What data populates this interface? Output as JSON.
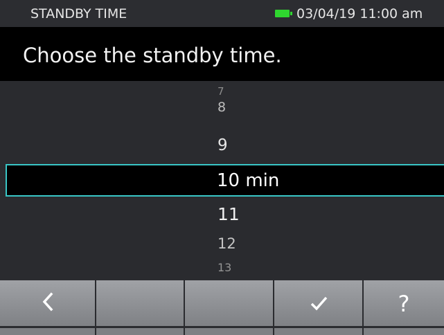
{
  "status_bar": {
    "title": "STANDBY TIME",
    "battery_icon": "battery-full-icon",
    "battery_color": "#2fd62f",
    "datetime": "03/04/19 11:00 am"
  },
  "prompt": {
    "text": "Choose the standby time."
  },
  "picker": {
    "items_above": [
      "7",
      "8",
      "9"
    ],
    "selected": "10 min",
    "items_below": [
      "11",
      "12",
      "13"
    ],
    "highlight_color": "#39c6c6"
  },
  "softkeys": [
    {
      "icon": "back-chevron-icon",
      "glyph": "<"
    },
    {
      "icon": "",
      "glyph": ""
    },
    {
      "icon": "",
      "glyph": ""
    },
    {
      "icon": "check-icon",
      "glyph": "✓"
    },
    {
      "icon": "help-icon",
      "glyph": "?"
    }
  ]
}
